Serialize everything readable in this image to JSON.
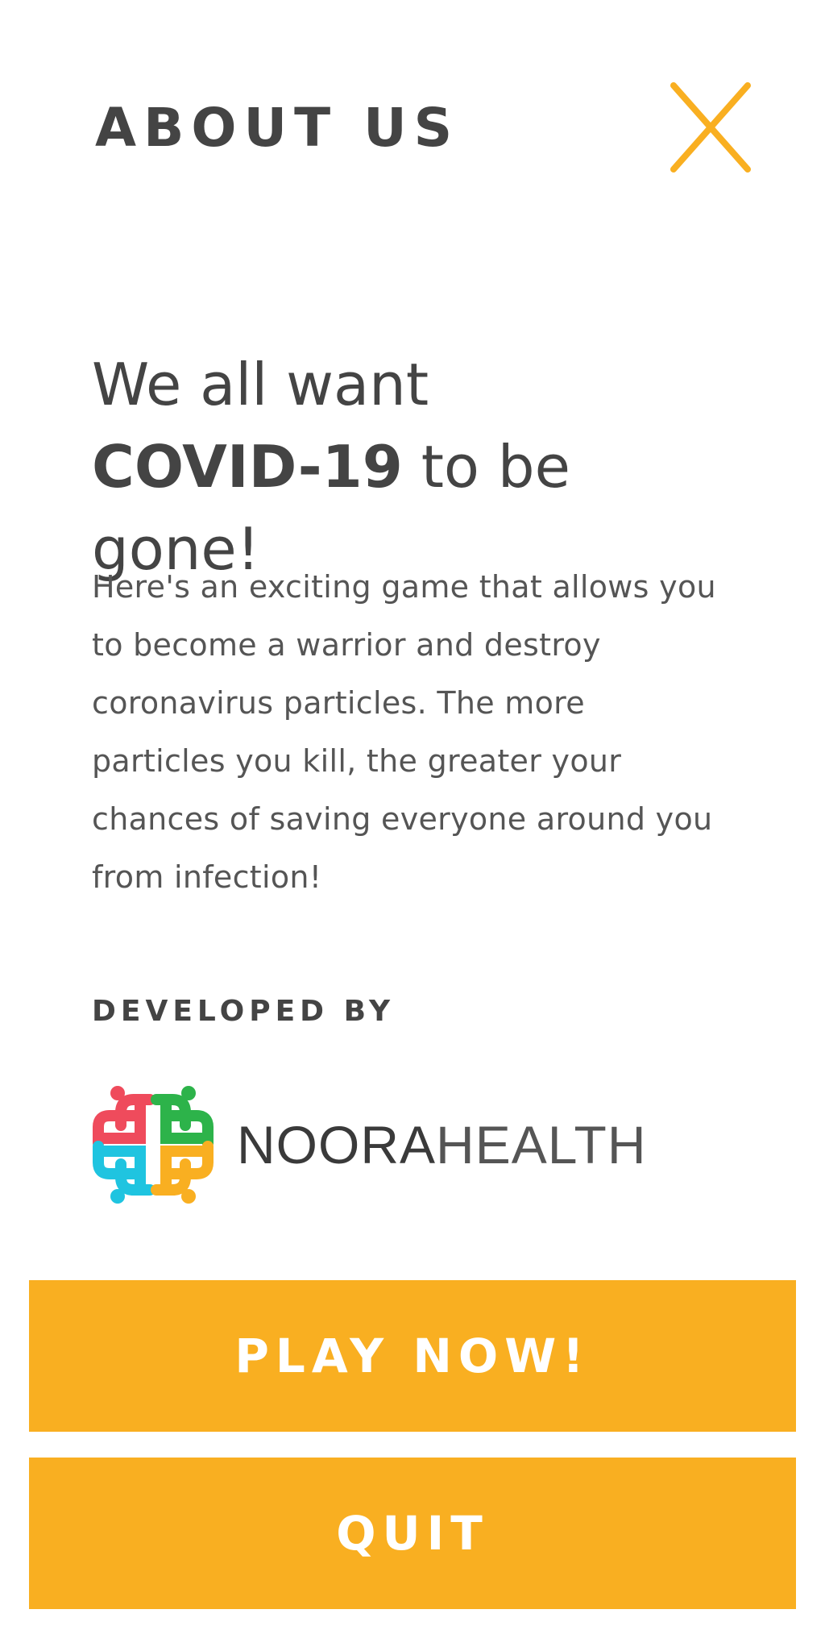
{
  "header": {
    "title": "ABOUT US",
    "close_icon": "close-icon"
  },
  "main": {
    "headline_line1": "We all want",
    "headline_emph": "COVID-19",
    "headline_rest": " to be gone!",
    "description": "Here's an exciting game that allows you to become a warrior and destroy coronavirus particles. The more particles you kill, the greater your chances of saving everyone around you from infection!"
  },
  "developer": {
    "label": "DEVELOPED BY",
    "logo_icon": "noora-health-logo",
    "name_part1": "NOORA",
    "name_part2": "HEALTH"
  },
  "buttons": {
    "play_label": "PLAY NOW!",
    "quit_label": "QUIT"
  },
  "colors": {
    "accent": "#F9AF21",
    "text": "#444444",
    "logo_red": "#EF4B5C",
    "logo_green": "#2DB34A",
    "logo_blue": "#1FC4E0",
    "logo_yellow": "#F9AF21"
  }
}
